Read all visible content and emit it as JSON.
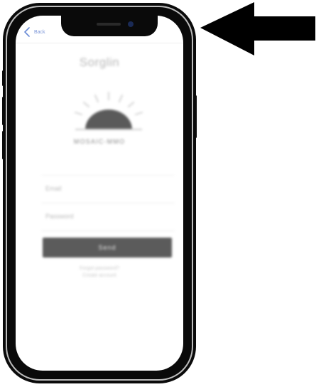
{
  "nav": {
    "back_label": "Back",
    "back_icon": "chevron-left-icon"
  },
  "screen": {
    "title": "Sorglin",
    "brand_name": "MOSAIC-MMO",
    "logo_icon": "sunrise-icon",
    "fields": [
      {
        "placeholder": "Email",
        "value": ""
      },
      {
        "placeholder": "Password",
        "value": ""
      }
    ],
    "submit_label": "Send",
    "links": [
      "Forgot password?",
      "Create account"
    ]
  },
  "annotation": {
    "arrow_icon": "arrow-left-icon",
    "arrow_color": "#000000"
  },
  "colors": {
    "button": "#5b5b5b",
    "back_link": "#6a8bd6"
  }
}
